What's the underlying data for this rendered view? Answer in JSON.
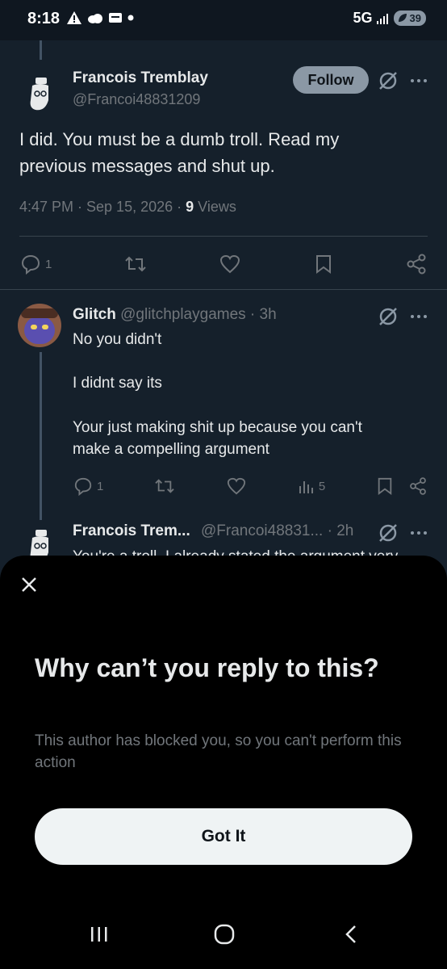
{
  "status": {
    "time": "8:18",
    "network": "5G",
    "battery": "39"
  },
  "post": {
    "name": "Francois Tremblay",
    "handle": "@Francoi48831209",
    "follow_label": "Follow",
    "text_line1": "I did. You must be a dumb troll. Read my",
    "text_line2": "previous messages and shut up.",
    "meta_time": "4:47 PM · Sep 15, 2026 · ",
    "meta_views_count": "9",
    "meta_views_label": " Views",
    "reply_count": "1"
  },
  "reply1": {
    "name": "Glitch",
    "handle_time": "@glitchplaygames · 3h",
    "line1": "No you didn't",
    "line2": "I didnt say its",
    "line3": "Your just making shit up because you can't",
    "line4": "make a compelling argument",
    "reply_count": "1",
    "views": "5"
  },
  "reply2": {
    "name": "Francois Trem...",
    "handle_time": "@Francoi48831... · 2h",
    "text_partial": "You're a troll. I already stated the argument very"
  },
  "sheet": {
    "title": "Why can’t you reply to this?",
    "subtitle": "This author has blocked you, so you can't perform this action",
    "button_label": "Got It"
  },
  "colors": {
    "bg": "#15202b",
    "sheet_bg": "#000000",
    "muted": "#71767b",
    "accent_button": "#eff3f4"
  }
}
